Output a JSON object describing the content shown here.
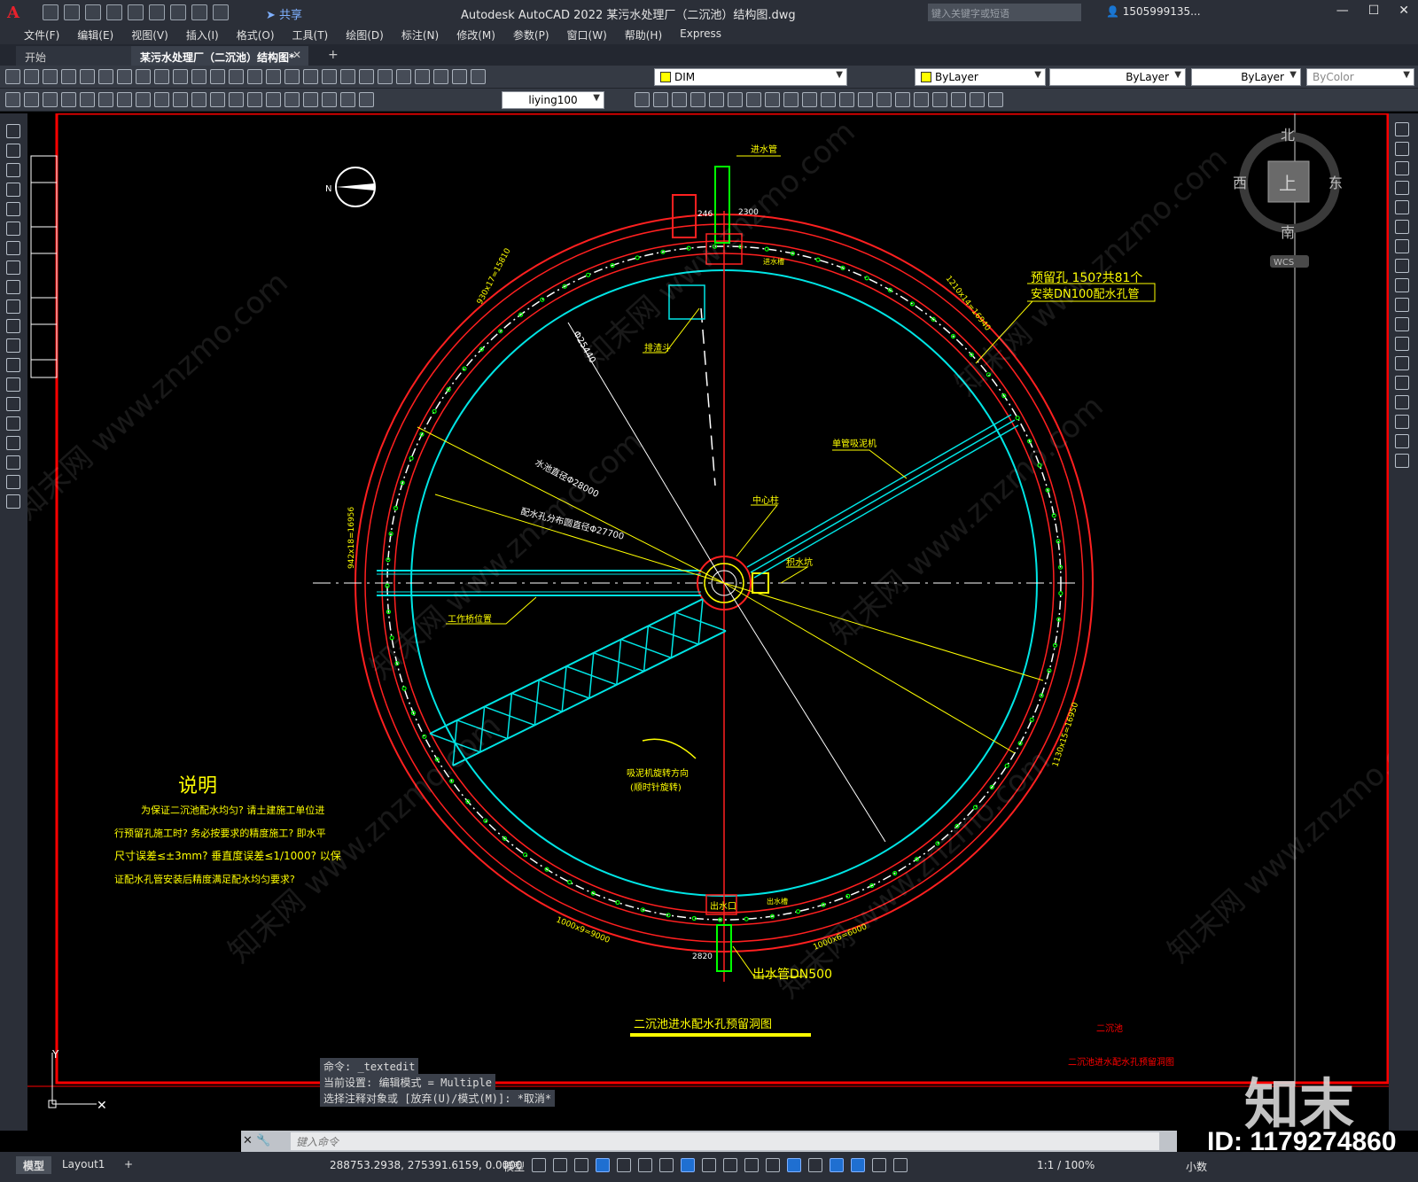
{
  "app": {
    "logo": "A",
    "share_label": "共享",
    "title": "Autodesk AutoCAD 2022   某污水处理厂（二沉池）结构图.dwg",
    "search_placeholder": "键入关键字或短语",
    "user": "1505999135...",
    "window_buttons": [
      "—",
      "☐",
      "✕"
    ]
  },
  "menu": [
    "文件(F)",
    "编辑(E)",
    "视图(V)",
    "插入(I)",
    "格式(O)",
    "工具(T)",
    "绘图(D)",
    "标注(N)",
    "修改(M)",
    "参数(P)",
    "窗口(W)",
    "帮助(H)",
    "Express"
  ],
  "tabs": {
    "start": "开始",
    "doc": "某污水处理厂（二沉池）结构图*",
    "close": "✕",
    "add": "+"
  },
  "toolbar": {
    "layer": "DIM",
    "color": "ByLayer",
    "linetype": "ByLayer",
    "lineweight": "ByLayer",
    "plotstyle": "ByColor",
    "textstyle": "liying100"
  },
  "viewcube": {
    "north": "北",
    "south": "南",
    "east": "东",
    "west": "西",
    "top": "上",
    "wcs": "WCS"
  },
  "drawing": {
    "inlet_pipe": "进水管",
    "dim_246": "246",
    "dim_2300": "2300",
    "inlet_trough": "进水槽",
    "holes_label_1": "预留孔 150?共81个",
    "holes_label_2": "安装DN100配水孔管",
    "dim_top_left": "930x17=15810",
    "dim_top_right": "1210x14=16940",
    "dim_left": "942x18=16956",
    "dim_right": "1130x15=16950",
    "dim_bottom_left": "1000x9=9000",
    "dim_bottom_right": "1000x6=6000",
    "diameter": "Φ25440",
    "scum": "排渣斗",
    "pool_diameter": "水池直径Φ28000",
    "hole_circle": "配水孔分布圆直径Φ27700",
    "bridge": "单管吸泥机",
    "center_column": "中心柱",
    "sump": "积水坑",
    "work_bridge": "工作桥位置",
    "rotation_1": "吸泥机旋转方向",
    "rotation_2": "(顺时针旋转)",
    "outlet": "出水口",
    "outlet_trough": "出水槽",
    "dim_2820": "2820",
    "outlet_pipe": "出水管DN500",
    "main_title": "二沉池进水配水孔预留洞图",
    "sheet_title_1": "二沉池",
    "sheet_title_2": "二沉池进水配水孔预留洞图",
    "notes_title": "说明",
    "notes": [
      "为保证二沉池配水均匀? 请土建施工单位进",
      "行预留孔施工时? 务必按要求的精度施工? 即水平",
      "尺寸误差≤±3mm? 垂直度误差≤1/1000? 以保",
      "证配水孔管安装后精度满足配水均匀要求?"
    ],
    "ucs_y": "Y",
    "ucs_x": "✕"
  },
  "command": {
    "history": [
      "命令: _textedit",
      "当前设置: 编辑模式 = Multiple",
      "选择注释对象或 [放弃(U)/模式(M)]: *取消*"
    ],
    "placeholder": "键入命令",
    "close": "✕"
  },
  "status": {
    "model_tab": "模型",
    "layout_tab": "Layout1",
    "add": "+",
    "coords": "288753.2938, 275391.6159, 0.0000",
    "model": "模型",
    "scale": "1:1 / 100%",
    "units": "小数"
  },
  "watermark": {
    "text": "知末网 www.znzmo.com",
    "logo": "知末",
    "id": "ID: 1179274860"
  },
  "colors": {
    "frame_red": "#ff0000",
    "cyan": "#00e5e5",
    "yellow": "#ffff00",
    "green": "#00ff00",
    "white": "#ffffff"
  }
}
